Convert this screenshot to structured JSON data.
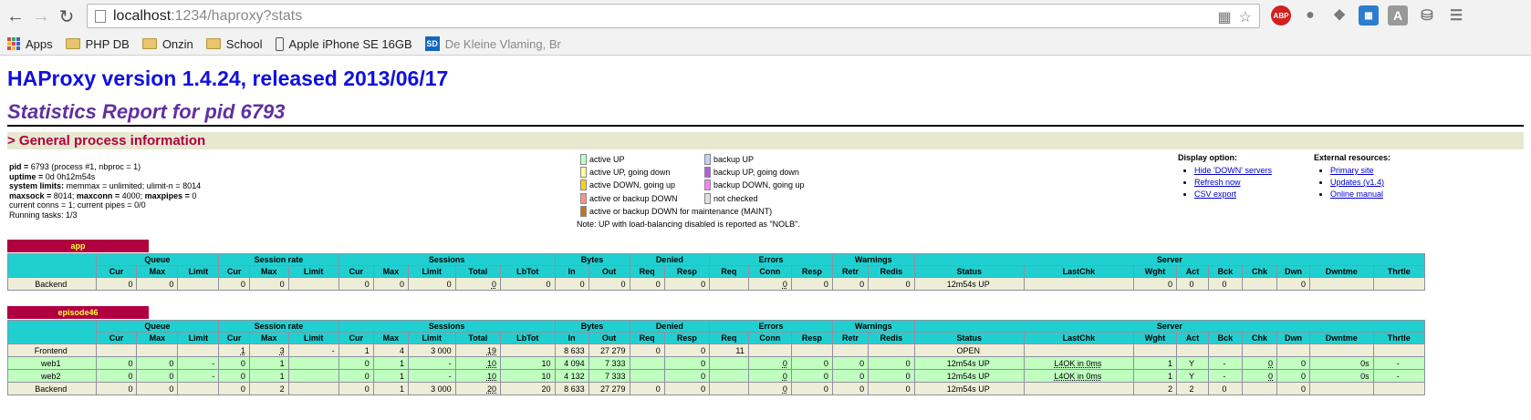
{
  "browser": {
    "url_host": "localhost",
    "url_rest": ":1234/haproxy?stats",
    "bookmarks": [
      {
        "label": "Apps",
        "icon": "apps-grid-icon"
      },
      {
        "label": "PHP DB",
        "icon": "folder-icon"
      },
      {
        "label": "Onzin",
        "icon": "folder-icon"
      },
      {
        "label": "School",
        "icon": "folder-icon"
      },
      {
        "label": "Apple iPhone SE 16GB",
        "icon": "phone-icon"
      },
      {
        "label": "De Kleine Vlaming, Br",
        "icon": "sd-icon"
      }
    ],
    "extensions": [
      "ABP",
      "A"
    ]
  },
  "page": {
    "title": "HAProxy version 1.4.24, released 2013/06/17",
    "subtitle": "Statistics Report for pid 6793",
    "general_header": "> General process information",
    "procinfo": {
      "line1_bold": "pid = ",
      "line1_val": "6793 (process #1, nbproc = 1)",
      "line2_bold": "uptime = ",
      "line2_val": "0d 0h12m54s",
      "line3_bold": "system limits: ",
      "line3_val": "memmax = unlimited; ulimit-n = 8014",
      "line4_a": "maxsock = ",
      "line4_b": "8014; ",
      "line4_c": "maxconn = ",
      "line4_d": "4000; ",
      "line4_e": "maxpipes = ",
      "line4_f": "0",
      "line5": "current conns = 1; current pipes = 0/0",
      "line6": "Running tasks: 1/3"
    },
    "legend": {
      "left": [
        {
          "label": "active UP",
          "color": "#c0ffc0"
        },
        {
          "label": "active UP, going down",
          "color": "#ffffa0"
        },
        {
          "label": "active DOWN, going up",
          "color": "#ffd020"
        },
        {
          "label": "active or backup DOWN",
          "color": "#ff9090"
        },
        {
          "label": "active or backup DOWN for maintenance (MAINT)",
          "color": "#c07820"
        }
      ],
      "right": [
        {
          "label": "backup UP",
          "color": "#c0d0ff"
        },
        {
          "label": "backup UP, going down",
          "color": "#b060e0"
        },
        {
          "label": "backup DOWN, going up",
          "color": "#ff80ff"
        },
        {
          "label": "not checked",
          "color": "#e0e0e0"
        }
      ],
      "note": "Note: UP with load-balancing disabled is reported as \"NOLB\"."
    },
    "display_option": {
      "title": "Display option:",
      "links": [
        "Hide 'DOWN' servers",
        "Refresh now",
        "CSV export"
      ]
    },
    "external_resources": {
      "title": "External resources:",
      "links": [
        "Primary site",
        "Updates (v1.4)",
        "Online manual"
      ]
    }
  },
  "headers": {
    "groups": [
      "Queue",
      "Session rate",
      "Sessions",
      "Bytes",
      "Denied",
      "Errors",
      "Warnings",
      "Server"
    ],
    "cols": [
      "Cur",
      "Max",
      "Limit",
      "Cur",
      "Max",
      "Limit",
      "Cur",
      "Max",
      "Limit",
      "Total",
      "LbTot",
      "In",
      "Out",
      "Req",
      "Resp",
      "Req",
      "Conn",
      "Resp",
      "Retr",
      "Redis",
      "Status",
      "LastChk",
      "Wght",
      "Act",
      "Bck",
      "Chk",
      "Dwn",
      "Dwntme",
      "Thrtle"
    ]
  },
  "proxies": [
    {
      "name": "app",
      "rows": [
        {
          "type": "be",
          "cells": [
            "Backend",
            "0",
            "0",
            "",
            "0",
            "0",
            "",
            "0",
            "0",
            "0",
            "0",
            "0",
            "0",
            "0",
            "0",
            "0",
            "",
            "0",
            "0",
            "0",
            "0",
            "12m54s UP",
            "",
            "0",
            "0",
            "0",
            "",
            "0",
            "",
            ""
          ]
        }
      ]
    },
    {
      "name": "episode46",
      "rows": [
        {
          "type": "fe",
          "cells": [
            "Frontend",
            "",
            "",
            "",
            "1",
            "3",
            "-",
            "1",
            "4",
            "3 000",
            "19",
            "",
            "8 633",
            "27 279",
            "0",
            "0",
            "11",
            "",
            "",
            "",
            "",
            "OPEN",
            "",
            "",
            "",
            "",
            "",
            "",
            "",
            ""
          ]
        },
        {
          "type": "up",
          "cells": [
            "web1",
            "0",
            "0",
            "-",
            "0",
            "1",
            "",
            "0",
            "1",
            "-",
            "10",
            "10",
            "4 094",
            "7 333",
            "",
            "0",
            "",
            "0",
            "0",
            "0",
            "0",
            "12m54s UP",
            "L4OK in 0ms",
            "1",
            "Y",
            "-",
            "0",
            "0",
            "0s",
            "-"
          ]
        },
        {
          "type": "up",
          "cells": [
            "web2",
            "0",
            "0",
            "-",
            "0",
            "1",
            "",
            "0",
            "1",
            "-",
            "10",
            "10",
            "4 132",
            "7 333",
            "",
            "0",
            "",
            "0",
            "0",
            "0",
            "0",
            "12m54s UP",
            "L4OK in 0ms",
            "1",
            "Y",
            "-",
            "0",
            "0",
            "0s",
            "-"
          ]
        },
        {
          "type": "be",
          "cells": [
            "Backend",
            "0",
            "0",
            "",
            "0",
            "2",
            "",
            "0",
            "1",
            "3 000",
            "20",
            "20",
            "8 633",
            "27 279",
            "0",
            "0",
            "",
            "0",
            "0",
            "0",
            "0",
            "12m54s UP",
            "",
            "2",
            "2",
            "0",
            "",
            "0",
            "",
            ""
          ]
        }
      ]
    }
  ]
}
